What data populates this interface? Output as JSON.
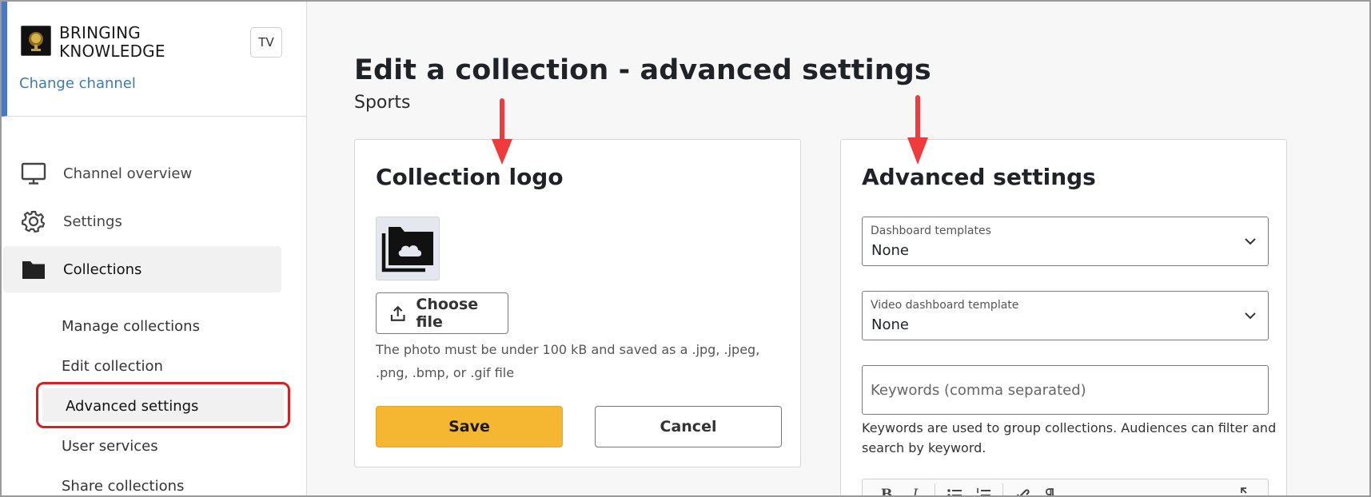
{
  "sidebar": {
    "org_name": "BRINGING KNOWLEDGE",
    "channel_badge": "TV",
    "change_channel": "Change channel",
    "nav": [
      {
        "label": "Channel overview",
        "icon": "monitor-icon"
      },
      {
        "label": "Settings",
        "icon": "gear-icon"
      },
      {
        "label": "Collections",
        "icon": "folder-icon"
      }
    ],
    "sub_items": [
      {
        "label": "Manage collections"
      },
      {
        "label": "Edit collection"
      },
      {
        "label": "Advanced settings",
        "active": true
      },
      {
        "label": "User services"
      },
      {
        "label": "Share collections"
      }
    ]
  },
  "main": {
    "title": "Edit a collection - advanced settings",
    "subtitle": "Sports",
    "logo_card": {
      "title": "Collection logo",
      "choose_file": "Choose file",
      "help": "The photo must be under 100 kB and saved as a .jpg, .jpeg, .png, .bmp, or .gif file",
      "save": "Save",
      "cancel": "Cancel"
    },
    "advanced_card": {
      "title": "Advanced settings",
      "dashboard_templates": {
        "label": "Dashboard templates",
        "value": "None"
      },
      "video_dashboard_template": {
        "label": "Video dashboard template",
        "value": "None"
      },
      "keywords": {
        "placeholder": "Keywords (comma separated)",
        "value": ""
      },
      "keywords_help": "Keywords are used to group collections. Audiences can filter and search by keyword.",
      "toolbar": {
        "bold": "B",
        "italic": "I"
      }
    }
  },
  "colors": {
    "accent_blue": "#4a78c7",
    "link": "#3d7ab8",
    "save_button": "#f5b731",
    "highlight_red": "#d91f1f",
    "arrow_red": "#ef3b3b"
  }
}
